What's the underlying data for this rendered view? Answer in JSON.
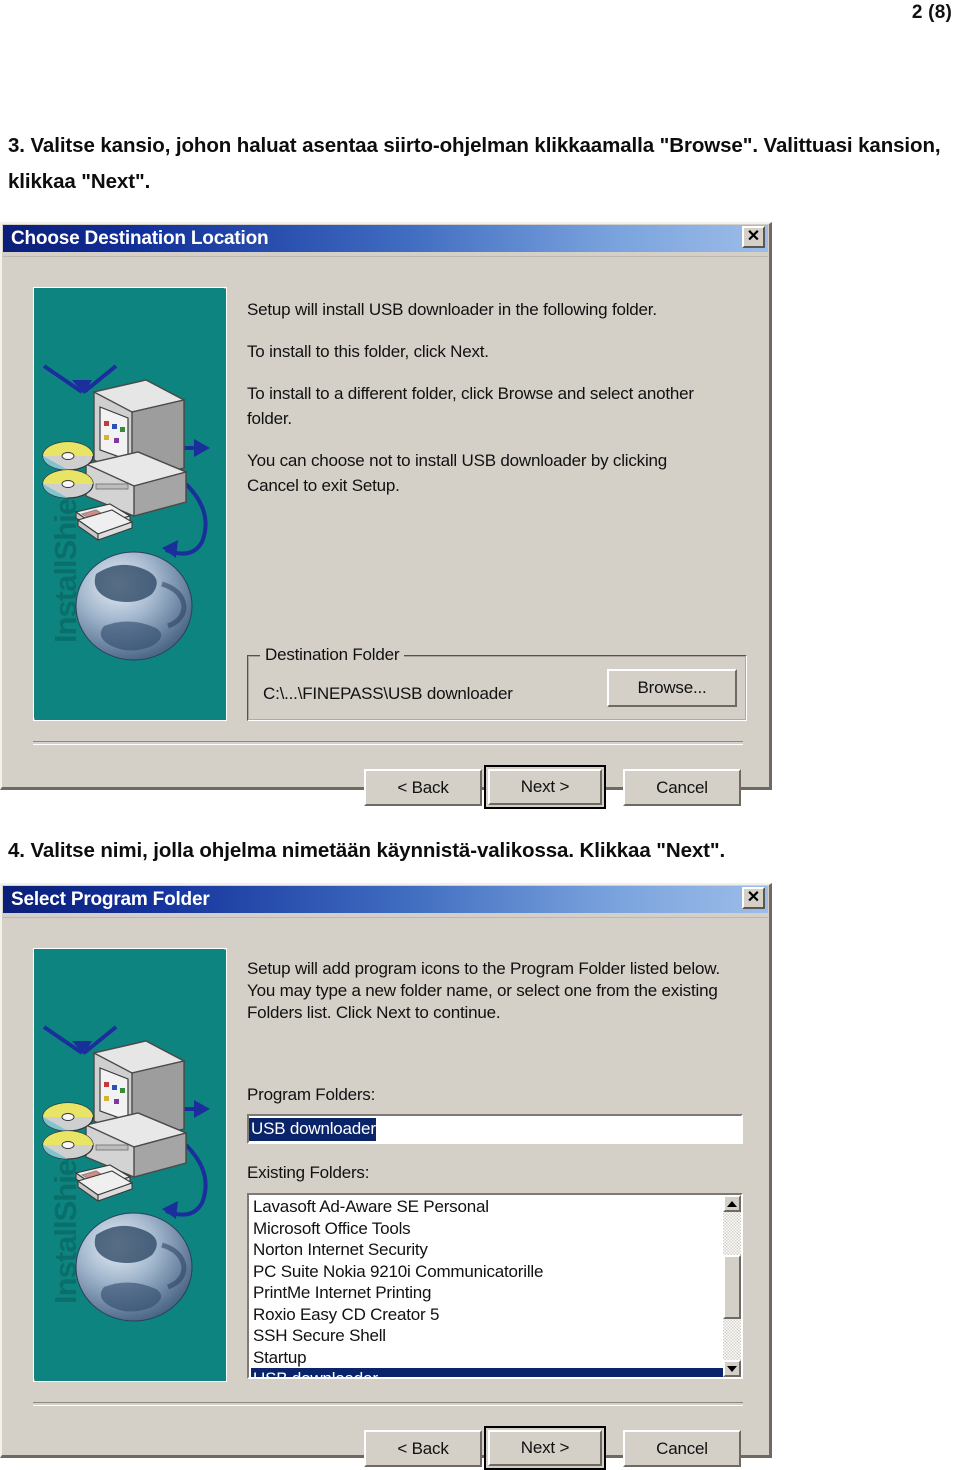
{
  "page": {
    "page_number": "2 (8)"
  },
  "instructions": [
    {
      "id": "step-3",
      "text": "3. Valitse kansio, johon haluat asentaa siirto-ohjelman klikkaamalla \"Browse\". Valittuasi kansion, klikkaa \"Next\"."
    },
    {
      "id": "step-4",
      "text": "4. Valitse nimi, jolla ohjelma nimetään käynnistä-valikossa. Klikkaa \"Next\"."
    }
  ],
  "dialogs": {
    "destination": {
      "title": "Choose Destination Location",
      "close_label": "✕",
      "artwork_label": "InstallShield",
      "paragraphs": [
        "Setup will install USB downloader in the following folder.",
        "To install to this folder, click Next.",
        "To install to a different folder, click Browse and select another folder.",
        "You can choose not to install USB downloader by clicking Cancel to exit Setup."
      ],
      "group": {
        "title": "Destination Folder",
        "path": "C:\\...\\FINEPASS\\USB downloader",
        "browse_label": "Browse..."
      },
      "buttons": {
        "back": "< Back",
        "next": "Next >",
        "cancel": "Cancel"
      }
    },
    "program_folder": {
      "title": "Select Program Folder",
      "close_label": "✕",
      "artwork_label": "InstallShield",
      "paragraphs": [
        "Setup will add program icons to the Program Folder listed below.",
        "You may type a new folder name, or select one from the existing",
        "Folders list.  Click Next to continue."
      ],
      "program_folders_label": "Program Folders:",
      "program_folders_value": "USB downloader",
      "existing_folders_label": "Existing Folders:",
      "existing_folders": [
        "Lavasoft Ad-Aware SE Personal",
        "Microsoft Office Tools",
        "Norton Internet Security",
        "PC Suite Nokia 9210i Communicatorille",
        "PrintMe Internet Printing",
        "Roxio Easy CD Creator 5",
        "SSH Secure Shell",
        "Startup",
        "USB downloader"
      ],
      "selected_folder": "USB downloader",
      "buttons": {
        "back": "< Back",
        "next": "Next >",
        "cancel": "Cancel"
      }
    }
  },
  "colors": {
    "dialog_face": "#d4d0c8",
    "titlebar_start": "#0b1e78",
    "titlebar_end": "#9dbde9",
    "artwork_bg": "#0d8480",
    "selection": "#0a246a"
  }
}
